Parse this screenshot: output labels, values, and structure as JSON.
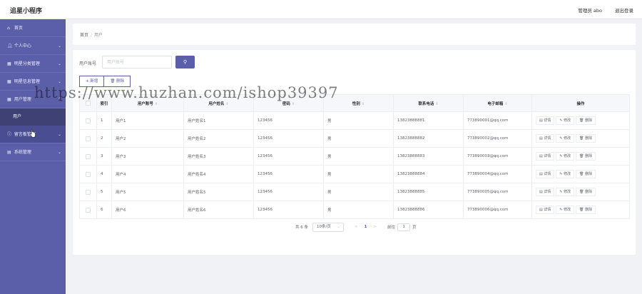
{
  "header": {
    "app_title": "追星小程序",
    "admin_label": "管理员 abo",
    "logout_label": "退出登录"
  },
  "sidebar": {
    "items": [
      {
        "label": "首页",
        "icon": "home-icon",
        "has_arrow": false
      },
      {
        "label": "个人中心",
        "icon": "user-icon",
        "has_arrow": true
      },
      {
        "label": "明星分类管理",
        "icon": "grid-icon",
        "has_arrow": true
      },
      {
        "label": "明星信息管理",
        "icon": "grid-icon",
        "has_arrow": true
      },
      {
        "label": "用户管理",
        "icon": "grid-icon",
        "has_arrow": true
      },
      {
        "label": "留言板管理",
        "icon": "message-icon",
        "has_arrow": true
      },
      {
        "label": "系统管理",
        "icon": "settings-icon",
        "has_arrow": true
      }
    ],
    "submenu_item": "用户"
  },
  "breadcrumb": {
    "home": "首页",
    "separator": "/",
    "current": "用户"
  },
  "search": {
    "label": "用户账号",
    "placeholder": "用户账号",
    "button_icon": "search-icon"
  },
  "toolbar": {
    "add_label": "+ 新增",
    "delete_label": "删除"
  },
  "watermark": "https://www.huzhan.com/ishop39397",
  "table": {
    "headers": [
      "",
      "索引",
      "用户账号",
      "用户姓名",
      "密码",
      "性别",
      "联系电话",
      "电子邮箱",
      "操作"
    ],
    "rows": [
      [
        "1",
        "用户1",
        "用户姓名1",
        "123456",
        "男",
        "13823888881",
        "773890001@qq.com"
      ],
      [
        "2",
        "用户2",
        "用户姓名2",
        "123456",
        "男",
        "13823888882",
        "773890002@qq.com"
      ],
      [
        "3",
        "用户3",
        "用户姓名3",
        "123456",
        "男",
        "13823888883",
        "773890003@qq.com"
      ],
      [
        "4",
        "用户4",
        "用户姓名4",
        "123456",
        "男",
        "13823888884",
        "773890004@qq.com"
      ],
      [
        "5",
        "用户5",
        "用户姓名5",
        "123456",
        "男",
        "13823888885",
        "773890005@qq.com"
      ],
      [
        "6",
        "用户6",
        "用户姓名6",
        "123456",
        "男",
        "13823888886",
        "773890006@qq.com"
      ]
    ],
    "actions": [
      "详情",
      "修改",
      "删除"
    ]
  },
  "pagination": {
    "total": "共 6 条",
    "page_size": "10条/页",
    "prev": "<",
    "current_page": "1",
    "next": ">",
    "goto_label": "前往",
    "goto_value": "1",
    "page_unit": "页"
  },
  "colors": {
    "accent": "#5b5ea8",
    "sidebar_bg": "#5b5ea8",
    "submenu_bg": "#3f4175"
  }
}
